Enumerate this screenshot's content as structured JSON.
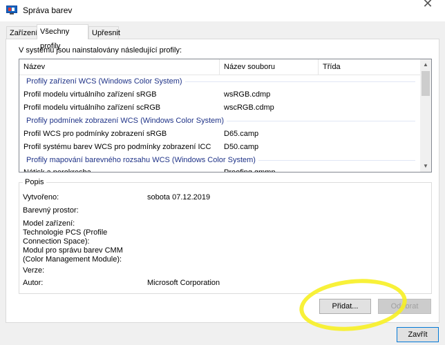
{
  "window": {
    "title": "Správa barev",
    "close_glyph": "✕"
  },
  "tabs": [
    {
      "label": "Zařízení"
    },
    {
      "label": "Všechny profily"
    },
    {
      "label": "Upřesnit"
    }
  ],
  "profiles": {
    "intro": "V systému jsou nainstalovány následující profily:",
    "columns": [
      "Název",
      "Název souboru",
      "Třída"
    ],
    "group1": {
      "label": "Profily zařízení WCS (Windows Color System)",
      "rows": [
        {
          "name": "Profil modelu virtuálního zařízení sRGB",
          "file": "wsRGB.cdmp"
        },
        {
          "name": "Profil modelu virtuálního zařízení scRGB",
          "file": "wscRGB.cdmp"
        }
      ]
    },
    "group2": {
      "label": "Profily podmínek zobrazení WCS (Windows Color System)",
      "rows": [
        {
          "name": "Profil WCS pro podmínky zobrazení sRGB",
          "file": "D65.camp"
        },
        {
          "name": "Profil systému barev WCS pro podmínky zobrazení ICC",
          "file": "D50.camp"
        }
      ]
    },
    "group3": {
      "label": "Profily mapování barevného rozsahu WCS (Windows Color System)",
      "rows": [
        {
          "name": "Nátisk a perokresba",
          "file": "Proofing.gmmp"
        }
      ]
    }
  },
  "description": {
    "title": "Popis",
    "created_label": "Vytvořeno:",
    "created_value": "sobota 07.12.2019",
    "colorspace_label": "Barevný prostor:",
    "device_model_label": "Model zařízení:",
    "pcs_label_1": "Technologie PCS (Profile",
    "pcs_label_2": "Connection Space):",
    "cmm_label_1": "Modul pro správu barev CMM",
    "cmm_label_2": "(Color Management Module):",
    "version_label": "Verze:",
    "author_label": "Autor:",
    "author_value": "Microsoft Corporation"
  },
  "buttons": {
    "add": "Přidat...",
    "remove": "Odebrat",
    "close": "Zavřít"
  },
  "colors": {
    "group_text": "#1e3287",
    "highlight": "#f7f023",
    "accent": "#0078d7"
  }
}
